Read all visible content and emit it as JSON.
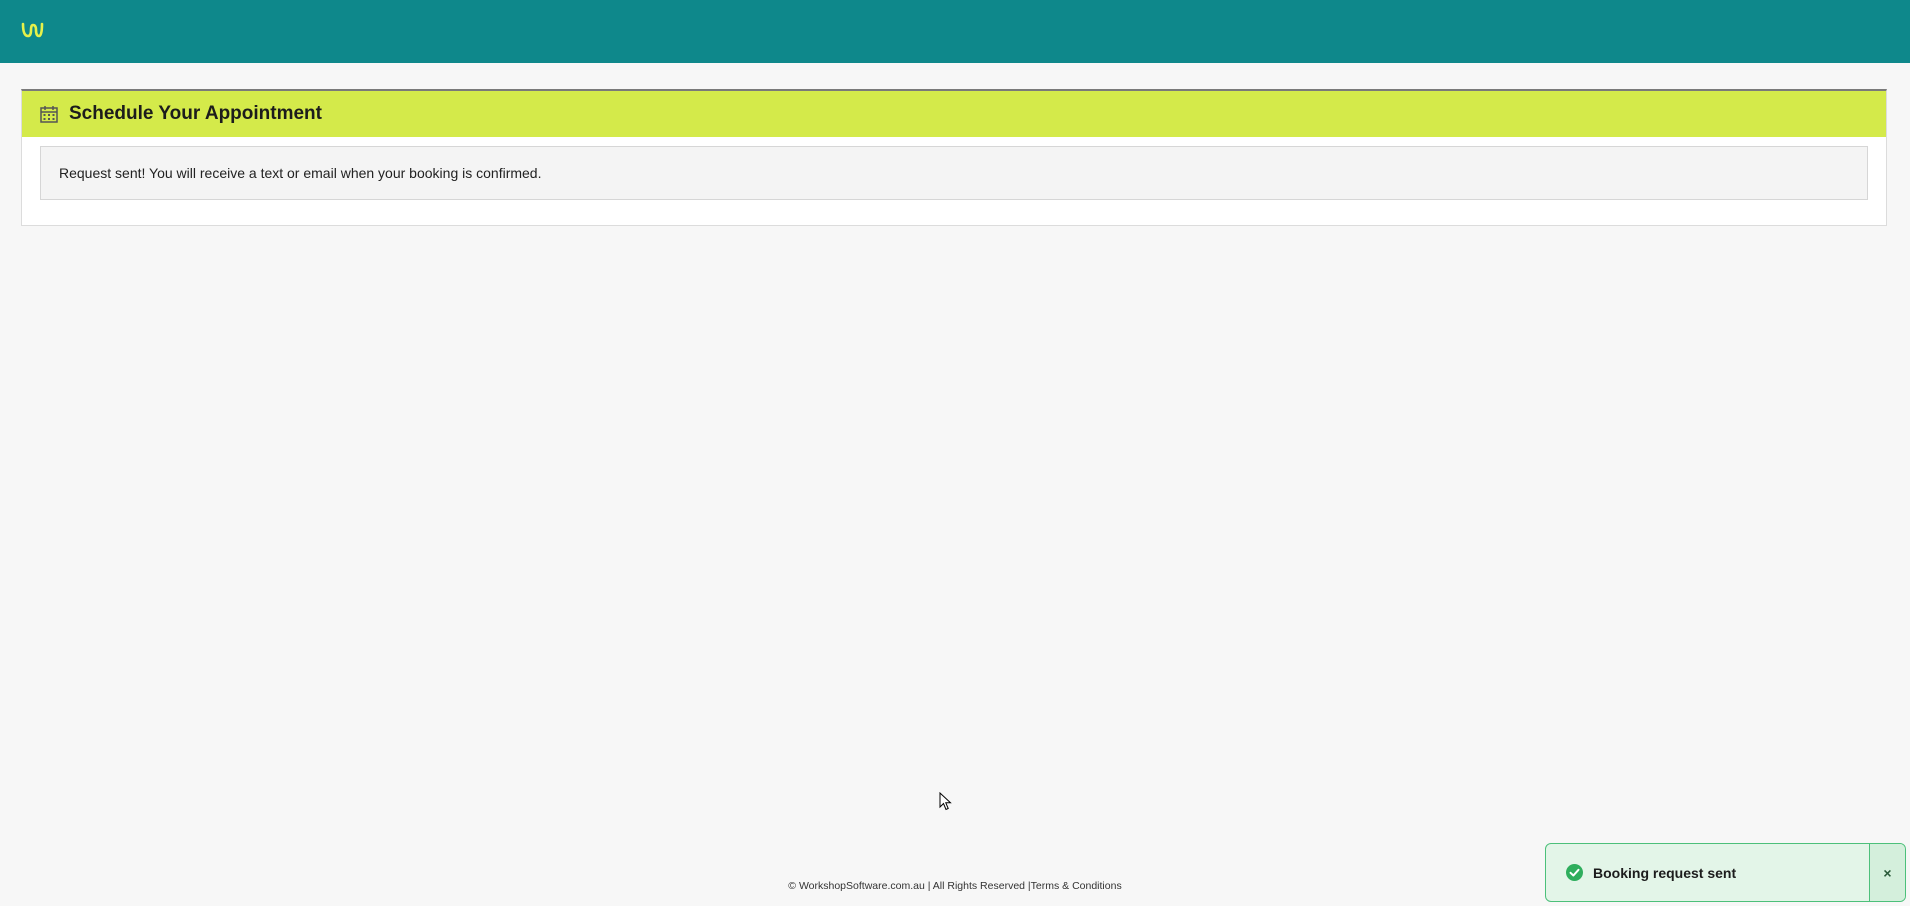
{
  "app": {
    "logo_icon": "workshop-logo-icon",
    "brand_color": "#0e888b",
    "accent_color": "#d4ea4a"
  },
  "panel": {
    "icon": "calendar-icon",
    "title": "Schedule Your Appointment",
    "message": "Request sent! You will receive a text or email when your booking is confirmed."
  },
  "footer": {
    "copyright": "© WorkshopSoftware.com.au | All Rights Reserved |",
    "terms_link": "Terms & Conditions"
  },
  "toast": {
    "icon": "check-circle-icon",
    "text": "Booking request sent",
    "close_label": "×",
    "status_color": "#4cc07a"
  }
}
